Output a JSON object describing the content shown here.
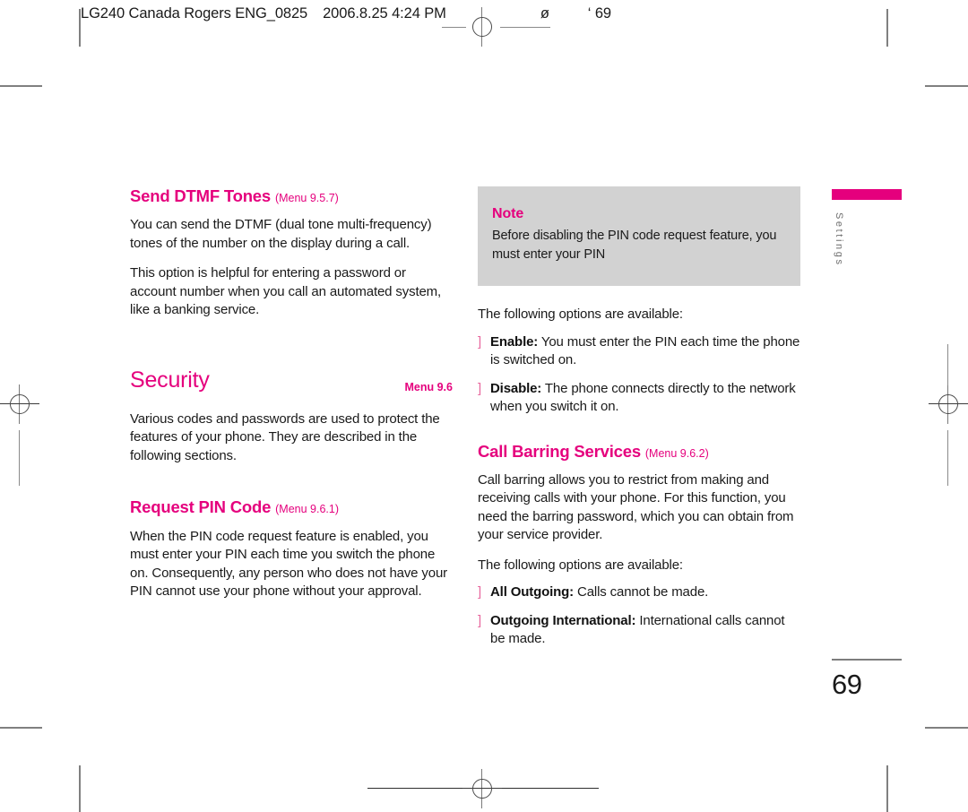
{
  "print_header": {
    "job": "LG240 Canada Rogers ENG_0825",
    "timestamp": "2006.8.25 4:24 PM",
    "mark_symbol": "ø",
    "page_marker": "‘ 69"
  },
  "left_column": {
    "dtmf": {
      "title": "Send DTMF Tones",
      "menu_ref": "(Menu 9.5.7)",
      "paragraphs": [
        "You can send the DTMF (dual tone multi-frequency) tones of the number on the display during a call.",
        "This option is helpful for entering a password or account number when you call an automated system, like a banking service."
      ]
    },
    "security": {
      "title": "Security",
      "menu_ref": "Menu 9.6",
      "paragraph": "Various codes and passwords are used to protect the features of your phone. They are described in the following sections."
    },
    "request_pin": {
      "title": "Request PIN Code",
      "menu_ref": "(Menu 9.6.1)",
      "paragraph": "When the PIN code request feature is enabled, you must enter your PIN each time you switch the phone on. Consequently, any person who does not have your PIN cannot use your phone without your approval."
    }
  },
  "right_column": {
    "note": {
      "label": "Note",
      "text": "Before disabling the PIN code request feature, you must enter your PIN"
    },
    "pin_options": {
      "intro": "The following options are available:",
      "bullet_glyph": "]",
      "items": [
        {
          "name": "Enable:",
          "text": " You must enter the PIN each time the phone is switched on."
        },
        {
          "name": "Disable:",
          "text": " The phone connects directly to the network when you switch it on."
        }
      ]
    },
    "call_barring": {
      "title": "Call Barring Services",
      "menu_ref": "(Menu 9.6.2)",
      "paragraph": "Call barring allows you to restrict from making and receiving calls with your phone. For this function, you need the barring password, which you can obtain from your service provider.",
      "intro": "The following options are available:",
      "bullet_glyph": "]",
      "items": [
        {
          "name": "All Outgoing:",
          "text": " Calls cannot be made."
        },
        {
          "name": "Outgoing International:",
          "text": " International calls cannot be made."
        }
      ]
    }
  },
  "side_tab": {
    "label": "Settings",
    "bar_color": "#e5007d"
  },
  "page_number": "69",
  "theme": {
    "accent": "#e5007d",
    "note_bg": "#d2d2d2",
    "body_text": "#1a1a1a"
  }
}
